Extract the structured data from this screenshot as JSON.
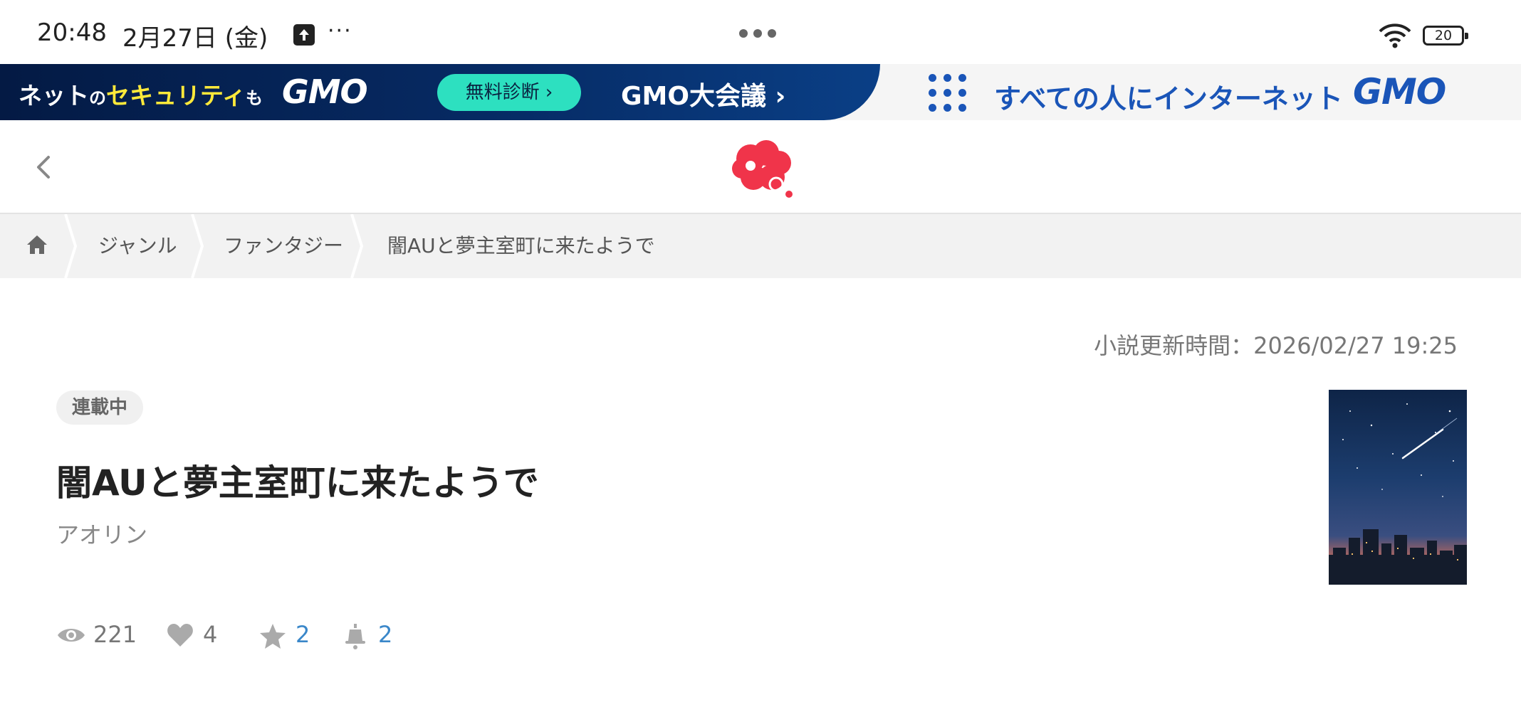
{
  "status_bar": {
    "time": "20:48",
    "date": "2月27日 (金)",
    "more": "···",
    "battery": "20"
  },
  "ad": {
    "left_text_pre": "ネット",
    "left_text_small": "の",
    "left_text_highlight": "セキュリティ",
    "left_text_post": "も",
    "brand": "GMO",
    "button_label": "無料診断",
    "event_label": "GMO大会議",
    "slogan": "すべての人にインターネット",
    "right_brand": "GMO",
    "colors": {
      "navy": "#062a63",
      "accent": "#2de0c0",
      "yellow": "#ffe93a",
      "blue": "#1a55b8"
    }
  },
  "header": {
    "logo_color": "#f0344a"
  },
  "breadcrumb": {
    "items": [
      "ジャンル",
      "ファンタジー",
      "闇AUと夢主室町に来たようで"
    ]
  },
  "novel": {
    "updated_label": "小説更新時間：2026/02/27 19:25",
    "status_badge": "連載中",
    "title": "闇AUと夢主室町に来たようで",
    "author": "アオリン",
    "stats": {
      "views": "221",
      "likes": "4",
      "stars": "2",
      "bookmarks": "2"
    }
  }
}
